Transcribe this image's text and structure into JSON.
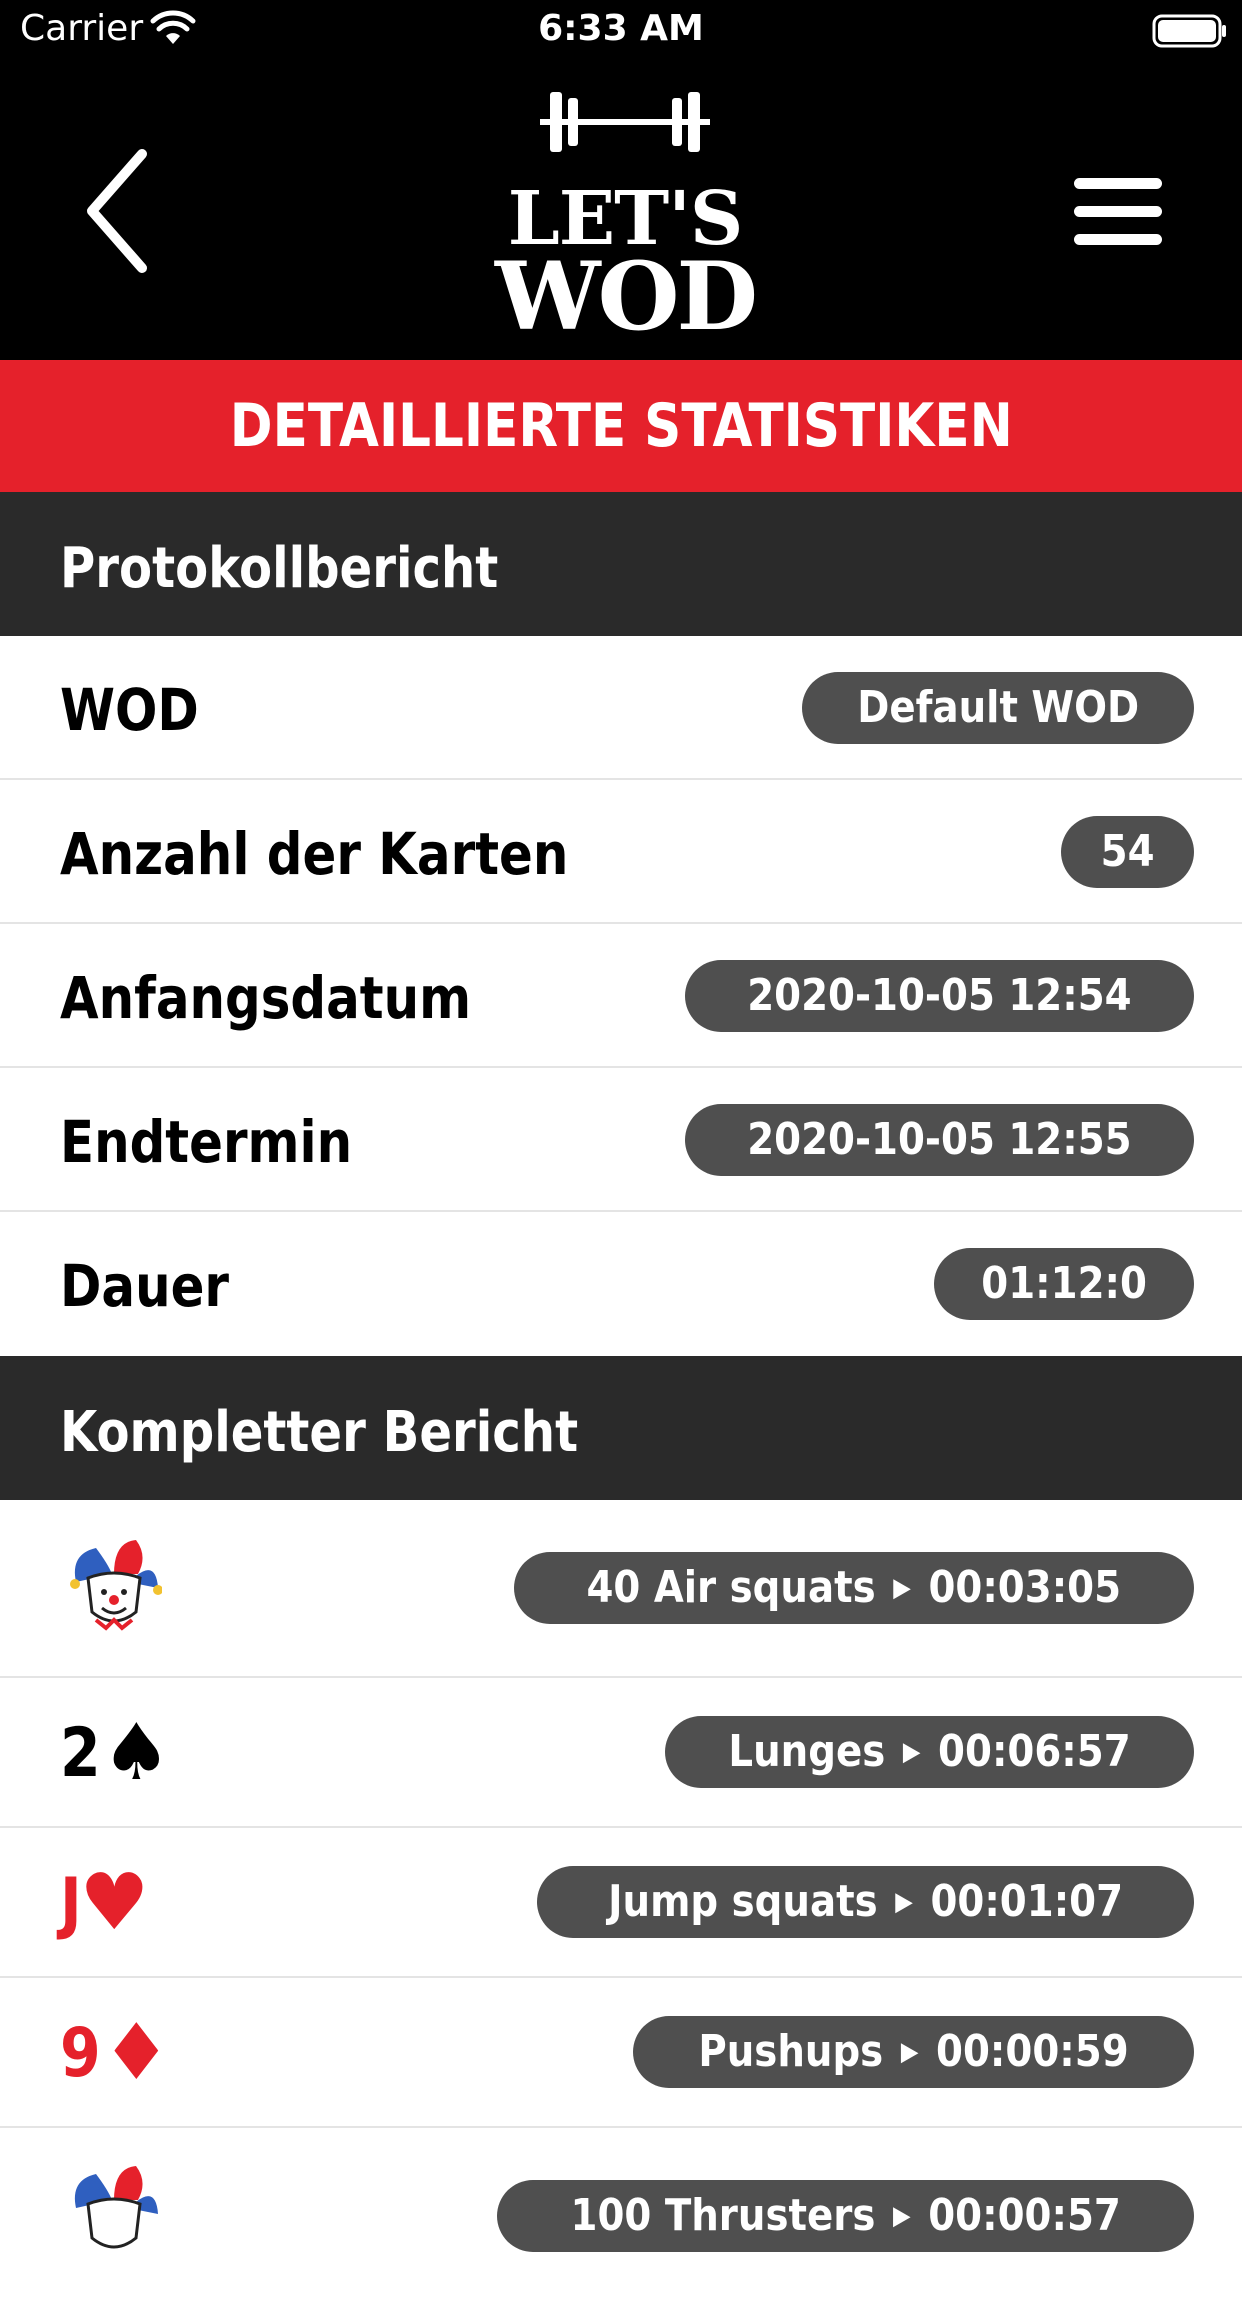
{
  "status_bar": {
    "carrier": "Carrier",
    "time": "6:33 AM"
  },
  "nav": {
    "logo_line1": "LET'S",
    "logo_line2": "WOD"
  },
  "banner": {
    "title": "DETAILLIERTE STATISTIKEN"
  },
  "protocol": {
    "header": "Protokollbericht",
    "rows": [
      {
        "label": "WOD",
        "value": "Default WOD"
      },
      {
        "label": "Anzahl der Karten",
        "value": "54"
      },
      {
        "label": "Anfangsdatum",
        "value": "2020-10-05 12:54"
      },
      {
        "label": "Endtermin",
        "value": "2020-10-05 12:55"
      },
      {
        "label": "Dauer",
        "value": "01:12:0"
      }
    ]
  },
  "complete": {
    "header": "Kompletter Bericht",
    "rows": [
      {
        "card": "joker",
        "exercise": "40 Air squats",
        "time": "00:03:05"
      },
      {
        "card_rank": "2",
        "card_suit": "♠",
        "suit_color": "#000000",
        "exercise": "Lunges",
        "time": "00:06:57"
      },
      {
        "card_rank": "J",
        "card_suit": "♥",
        "suit_color": "#e5212b",
        "exercise": "Jump squats",
        "time": "00:01:07"
      },
      {
        "card_rank": "9",
        "card_suit": "♦",
        "suit_color": "#e5212b",
        "exercise": "Pushups",
        "time": "00:00:59"
      },
      {
        "card": "joker",
        "exercise": "100 Thrusters",
        "time": "00:00:57"
      }
    ]
  },
  "colors": {
    "accent_red": "#e5212b",
    "pill_gray": "#4f4f4f",
    "section_dark": "#2a2a2a"
  },
  "icons": {
    "back": "chevron-left-icon",
    "menu": "hamburger-menu-icon",
    "arrow": "play-arrow-icon",
    "joker": "jester-icon"
  }
}
